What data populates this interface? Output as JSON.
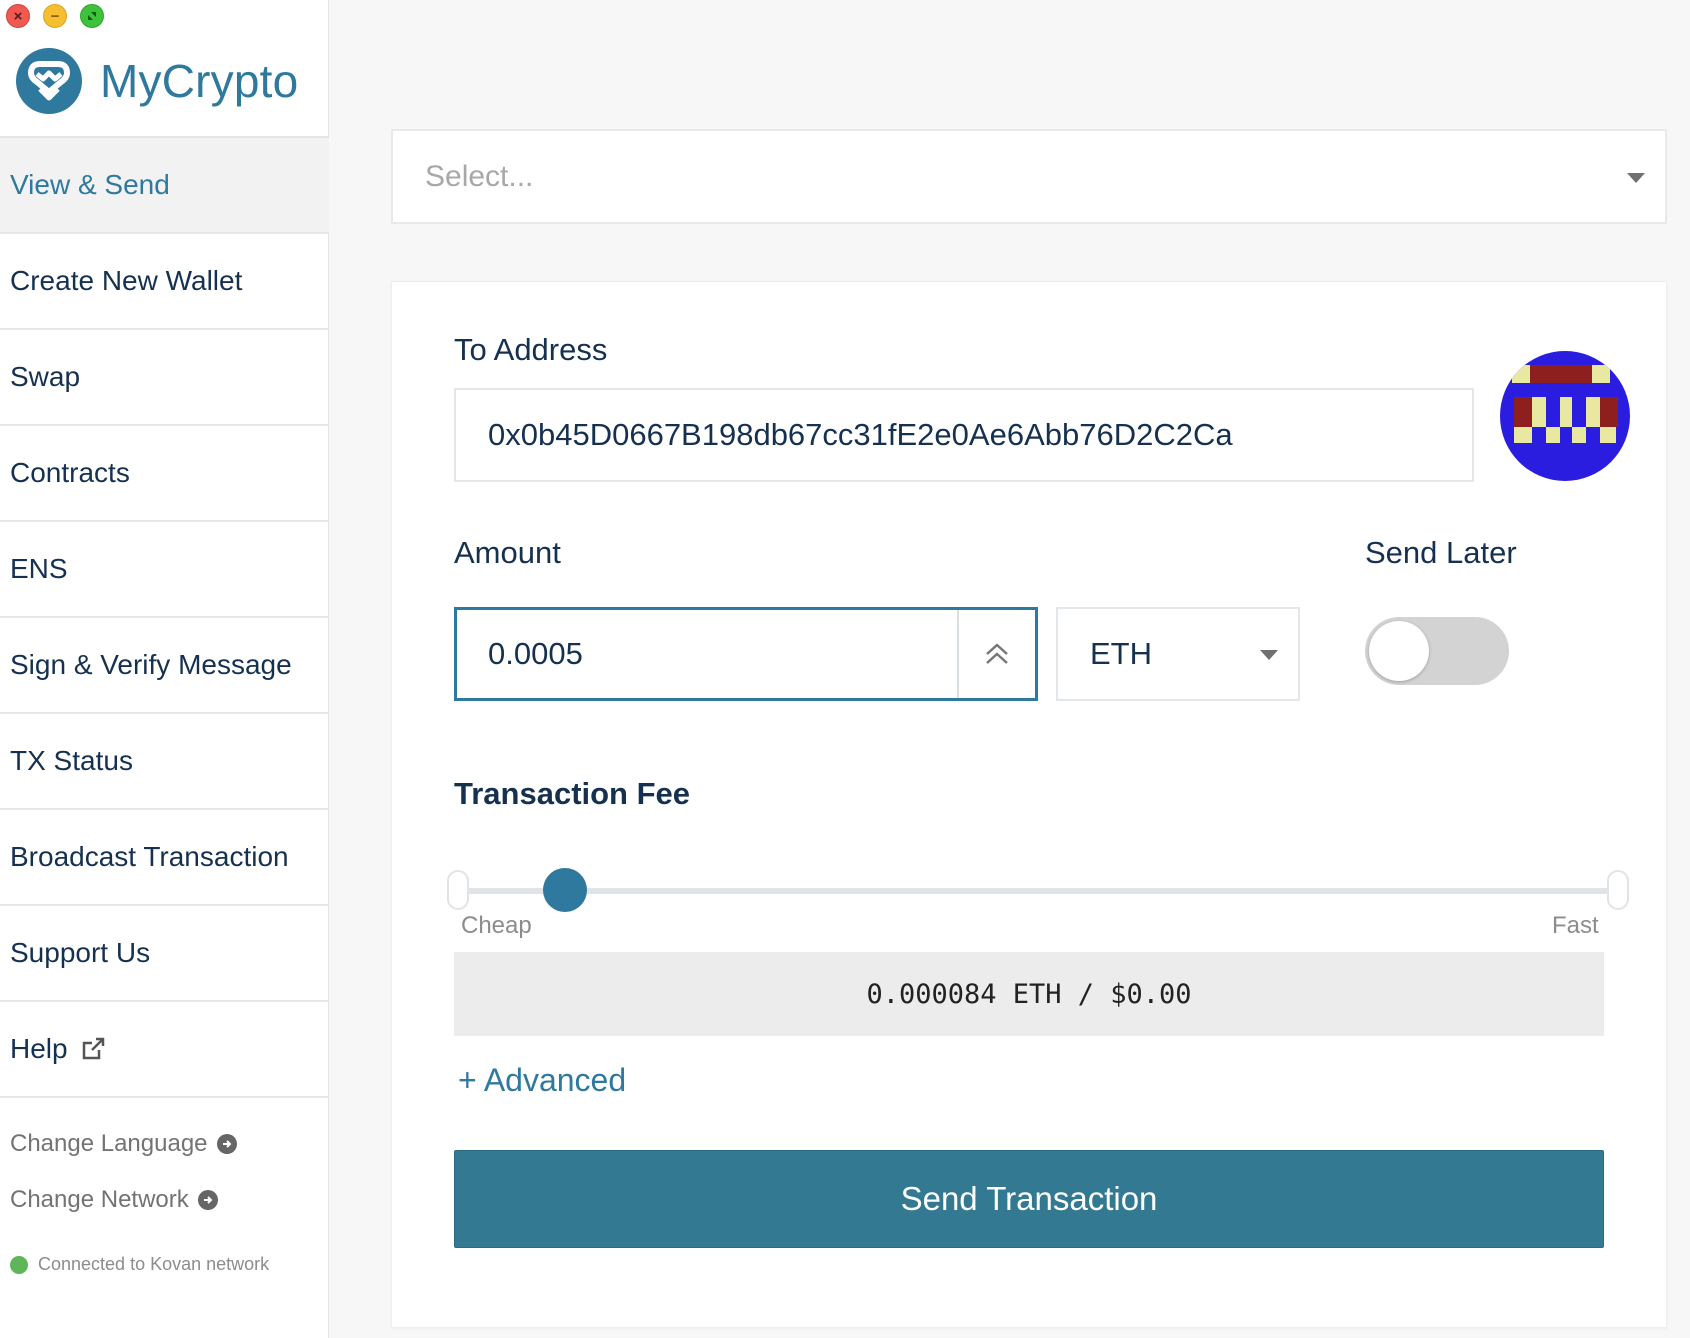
{
  "window": {
    "controls": [
      "close",
      "minimize",
      "maximize"
    ]
  },
  "brand": {
    "name": "MyCrypto",
    "color": "#2f799e"
  },
  "sidebar": {
    "items": [
      {
        "label": "View & Send",
        "active": true
      },
      {
        "label": "Create New Wallet"
      },
      {
        "label": "Swap"
      },
      {
        "label": "Contracts"
      },
      {
        "label": "ENS"
      },
      {
        "label": "Sign & Verify Message"
      },
      {
        "label": "TX Status"
      },
      {
        "label": "Broadcast Transaction"
      },
      {
        "label": "Support Us"
      },
      {
        "label": "Help",
        "icon": "external-link-icon"
      }
    ],
    "change_language": "Change Language",
    "change_network": "Change Network",
    "network_status": "Connected to Kovan network",
    "network_status_color": "#5fb65a"
  },
  "wallet_select": {
    "placeholder": "Select..."
  },
  "form": {
    "to_address_label": "To Address",
    "to_address_value": "0x0b45D0667B198db67cc31fE2e0Ae6Abb76D2C2Ca",
    "amount_label": "Amount",
    "amount_value": "0.0005",
    "unit_value": "ETH",
    "send_later_label": "Send Later",
    "send_later_enabled": false,
    "fee_label": "Transaction Fee",
    "fee_slider": {
      "min_label": "Cheap",
      "max_label": "Fast",
      "position": 0.09
    },
    "fee_display": "0.000084 ETH / $0.00",
    "advanced_label": "+ Advanced",
    "send_button_label": "Send Transaction",
    "send_button_color": "#337992"
  }
}
